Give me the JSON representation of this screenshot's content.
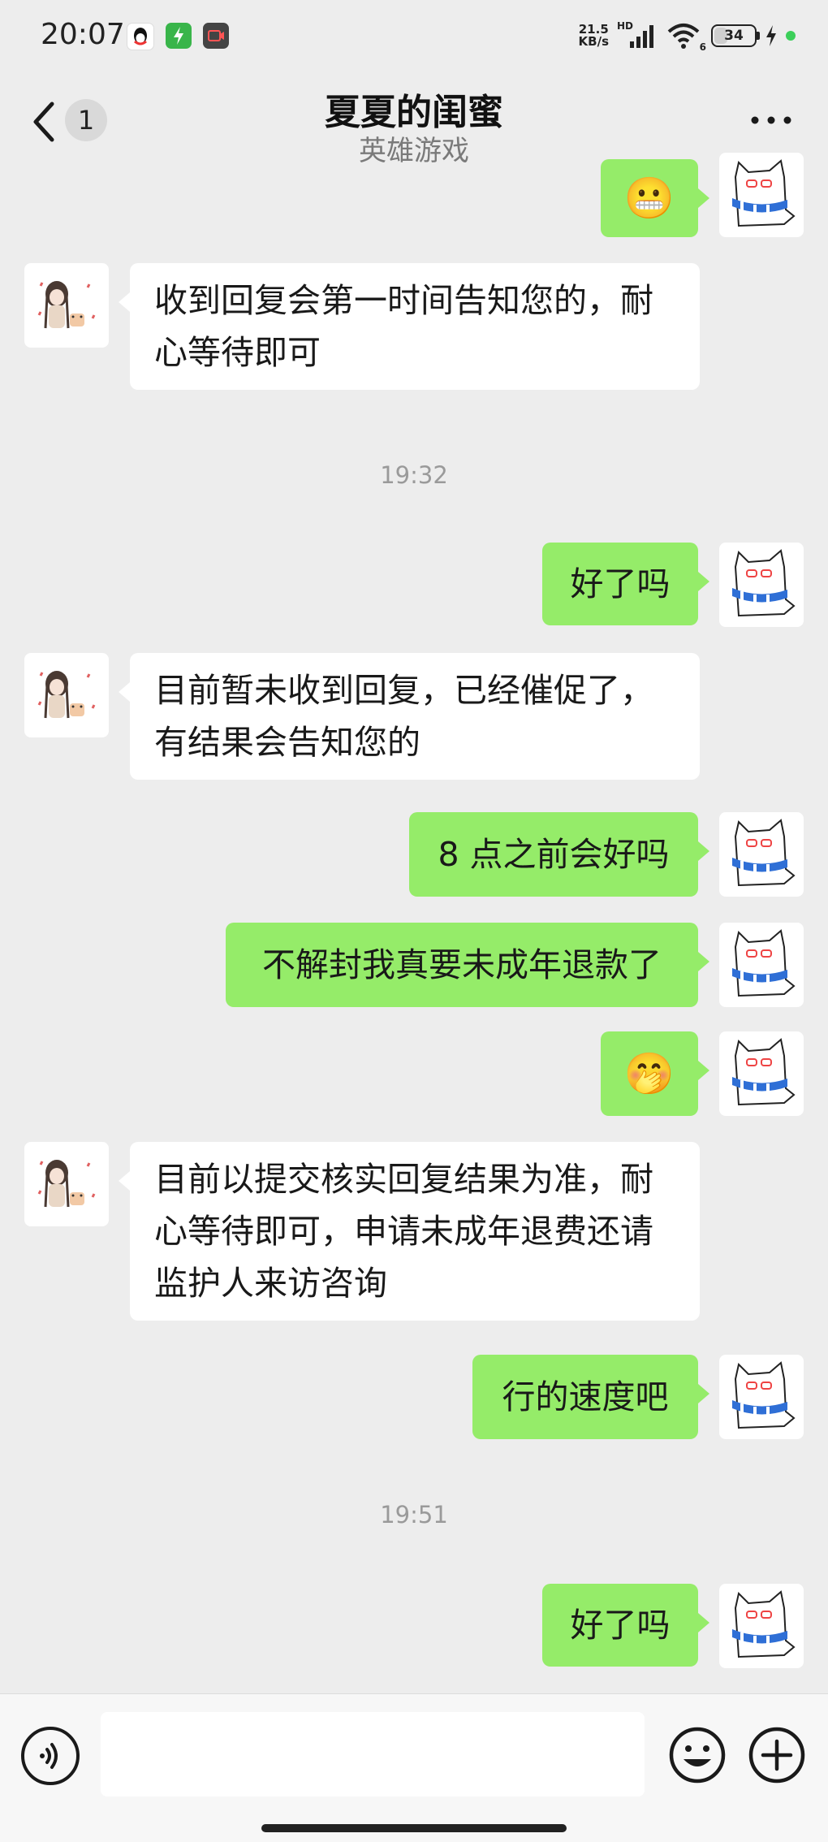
{
  "status_bar": {
    "time": "20:07",
    "net_speed_top": "21.5",
    "net_speed_unit": "KB/s",
    "hd": "HD",
    "signal_icon": "signal-bars-icon",
    "wifi_icon": "wifi-icon",
    "wifi_label": "6",
    "battery": "34",
    "battery_level_pct": 34,
    "charging_icon": "lightning-icon"
  },
  "header": {
    "back_icon": "chevron-left-icon",
    "unread_count": "1",
    "title": "夏夏的闺蜜",
    "subtitle": "英雄游戏",
    "more_icon": "more-dots-icon"
  },
  "messages": [
    {
      "side": "out",
      "kind": "emoji",
      "text": "😬"
    },
    {
      "side": "in",
      "kind": "text",
      "text": "收到回复会第一时间告知您的，耐心等待即可"
    },
    {
      "side": "sep",
      "text": "19:32"
    },
    {
      "side": "out",
      "kind": "text",
      "text": "好了吗"
    },
    {
      "side": "in",
      "kind": "text",
      "text": "目前暂未收到回复，已经催促了，有结果会告知您的"
    },
    {
      "side": "out",
      "kind": "text",
      "text": "8 点之前会好吗"
    },
    {
      "side": "out",
      "kind": "text",
      "text": "不解封我真要未成年退款了"
    },
    {
      "side": "out",
      "kind": "emoji",
      "text": "🤭"
    },
    {
      "side": "in",
      "kind": "text",
      "text": "目前以提交核实回复结果为准，耐心等待即可，申请未成年退费还请监护人来访咨询"
    },
    {
      "side": "out",
      "kind": "text",
      "text": "行的速度吧"
    },
    {
      "side": "sep",
      "text": "19:51"
    },
    {
      "side": "out",
      "kind": "text",
      "text": "好了吗"
    }
  ],
  "input_bar": {
    "voice_icon": "voice-icon",
    "input_value": "",
    "emoji_icon": "emoji-smile-icon",
    "plus_icon": "plus-circle-icon"
  },
  "colors": {
    "background": "#ededed",
    "bubble_out": "#95ec69",
    "bubble_in": "#ffffff",
    "timestamp": "#9a9a9a"
  }
}
